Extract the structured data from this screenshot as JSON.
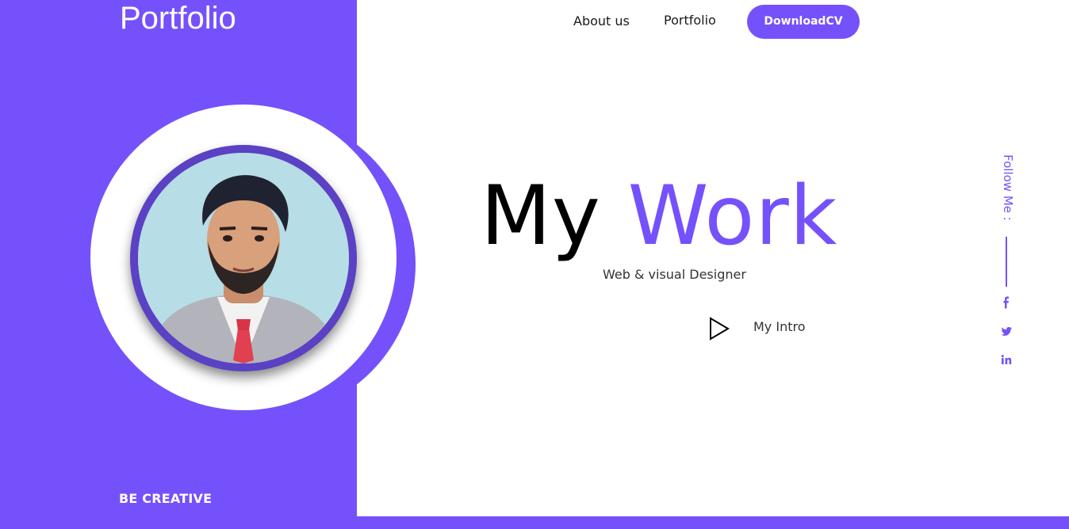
{
  "brand": "Portfolio",
  "nav": {
    "about": "About us",
    "portfolio": "Portfolio",
    "download_cv": "DownloadCV"
  },
  "hero": {
    "title_part1": "My",
    "title_part2": "Work",
    "subtitle": "Web & visual Designer",
    "intro_label": "My Intro"
  },
  "sidebar": {
    "tagline": "BE CREATIVE"
  },
  "social": {
    "follow_label": "Follow Me :",
    "icons": [
      "facebook-icon",
      "twitter-icon",
      "linkedin-icon"
    ]
  },
  "colors": {
    "accent": "#7551fb",
    "text": "#000000",
    "background": "#ffffff"
  }
}
